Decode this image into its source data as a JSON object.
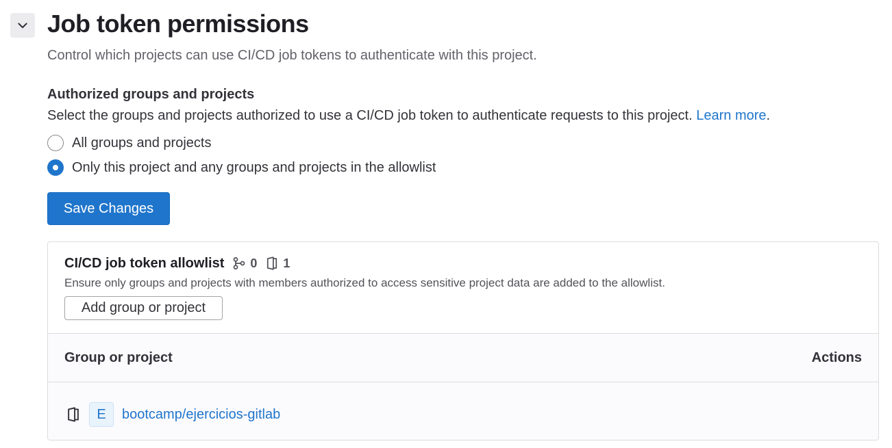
{
  "header": {
    "title": "Job token permissions",
    "description": "Control which projects can use CI/CD job tokens to authenticate with this project."
  },
  "authorized": {
    "heading": "Authorized groups and projects",
    "description": "Select the groups and projects authorized to use a CI/CD job token to authenticate requests to this project.",
    "learn_more": "Learn more",
    "period": ".",
    "options": [
      {
        "label": "All groups and projects",
        "checked": false
      },
      {
        "label": "Only this project and any groups and projects in the allowlist",
        "checked": true
      }
    ],
    "save_label": "Save Changes"
  },
  "allowlist": {
    "title": "CI/CD job token allowlist",
    "group_count": "0",
    "project_count": "1",
    "description": "Ensure only groups and projects with members authorized to access sensitive project data are added to the allowlist.",
    "add_label": "Add group or project",
    "columns": {
      "name": "Group or project",
      "actions": "Actions"
    },
    "rows": [
      {
        "avatar_letter": "E",
        "path": "bootcamp/ejercicios-gitlab",
        "icon": "project-icon"
      }
    ]
  },
  "colors": {
    "accent": "#1f75cb",
    "text": "#333238",
    "muted": "#626168"
  }
}
